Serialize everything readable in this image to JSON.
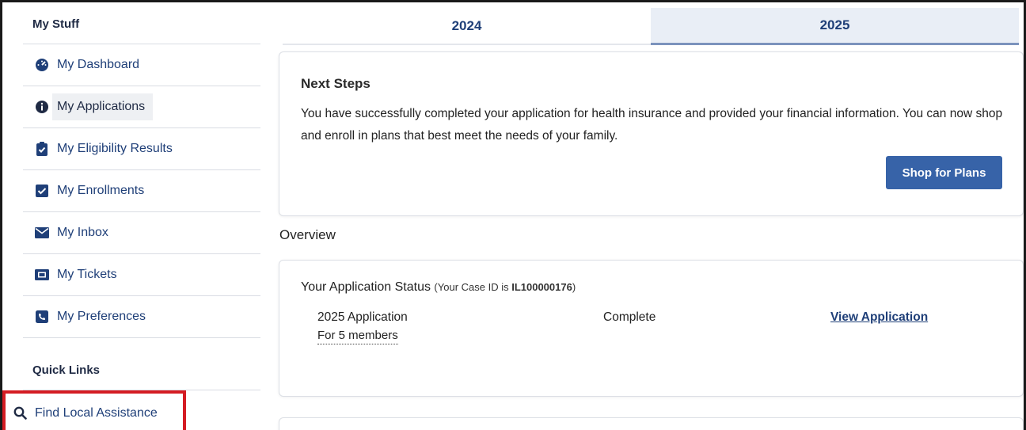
{
  "sidebar": {
    "header": "My Stuff",
    "items": [
      {
        "label": "My Dashboard",
        "icon": "dashboard-gauge-icon"
      },
      {
        "label": "My Applications",
        "icon": "info-circle-icon",
        "active": true
      },
      {
        "label": "My Eligibility Results",
        "icon": "clipboard-check-icon"
      },
      {
        "label": "My Enrollments",
        "icon": "checkbox-icon"
      },
      {
        "label": "My Inbox",
        "icon": "envelope-icon"
      },
      {
        "label": "My Tickets",
        "icon": "ticket-icon"
      },
      {
        "label": "My Preferences",
        "icon": "phone-square-icon"
      }
    ],
    "quick_links_header": "Quick Links",
    "quick_link": {
      "label": "Find Local Assistance",
      "icon": "search-icon"
    }
  },
  "tabs": [
    {
      "label": "2024",
      "selected": false
    },
    {
      "label": "2025",
      "selected": true
    }
  ],
  "next_steps": {
    "title": "Next Steps",
    "text": "You have successfully completed your application for health insurance and provided your financial information. You can now shop and enroll in plans that best meet the needs of your family.",
    "button": "Shop for Plans"
  },
  "overview": {
    "title": "Overview",
    "status_title": "Your Application Status",
    "case_prefix": "(Your Case ID is ",
    "case_id": "IL100000176",
    "case_suffix": ")",
    "row": {
      "name": "2025 Application",
      "members": "For 5 members",
      "status": "Complete",
      "link": "View Application"
    }
  },
  "colors": {
    "link": "#1f3f78",
    "button": "#3763a8",
    "highlight_border": "#d41c23",
    "tab_selected": "#e9eef6"
  }
}
